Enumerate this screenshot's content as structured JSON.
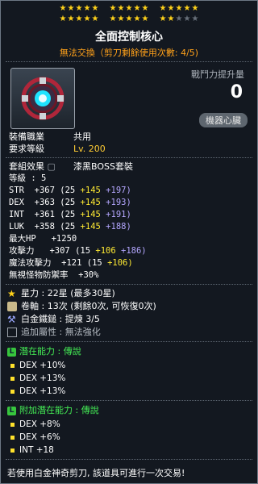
{
  "stars": {
    "row1": [
      [
        1,
        1,
        1,
        1,
        1
      ],
      [
        1,
        1,
        1,
        1,
        1
      ],
      [
        1,
        1,
        1,
        1,
        1
      ]
    ],
    "row2": [
      [
        1,
        1,
        1,
        1,
        1
      ],
      [
        1,
        1,
        1,
        1,
        1
      ],
      [
        1,
        1,
        0,
        0,
        0
      ]
    ],
    "filled_color": "#ffd21a",
    "empty_color": "#68707a"
  },
  "item": {
    "name": "全面控制核心",
    "trade_status": "無法交換（剪刀剩餘使用次數: 4/5)",
    "icon": "machine-heart-core-icon"
  },
  "power": {
    "label": "戰鬥力提升量",
    "value": "0"
  },
  "slot_badge": "機器心臟",
  "meta": [
    {
      "key": "裝備職業",
      "value": "共用",
      "color": "white"
    },
    {
      "key": "要求等級",
      "value": "Lv. 200",
      "color": "gold"
    }
  ],
  "set": {
    "key": "套組效果",
    "value": "漆黑BOSS套裝"
  },
  "level_line": "等級 : 5",
  "stats": [
    {
      "name": "STR",
      "total": "+367",
      "base": "(25",
      "bonus1": "+145",
      "bonus2": "+197)"
    },
    {
      "name": "DEX",
      "total": "+363",
      "base": "(25",
      "bonus1": "+145",
      "bonus2": "+193)"
    },
    {
      "name": "INT",
      "total": "+361",
      "base": "(25",
      "bonus1": "+145",
      "bonus2": "+191)"
    },
    {
      "name": "LUK",
      "total": "+358",
      "base": "(25",
      "bonus1": "+145",
      "bonus2": "+188)"
    }
  ],
  "hp_line": "最大HP   +1250",
  "attack": {
    "label": "攻擊力",
    "total": "+307",
    "base": "(15",
    "b1": "+106",
    "b2": "+186)"
  },
  "magic": {
    "label": "魔法攻擊力",
    "total": "+121",
    "base": "(15",
    "b1": "+106)"
  },
  "ignore_def": {
    "label": "無視怪物防禦率",
    "value": "+30%"
  },
  "misc": [
    {
      "icon": "star-icon",
      "text": "星力 : 22星 (最多30星)"
    },
    {
      "icon": "scroll-icon",
      "text": "卷軸 : 13次 (剩餘0次, 可恢復0次)"
    },
    {
      "icon": "hammer-icon",
      "text": "白金鐵鎚 : 提煉 3/5"
    },
    {
      "icon": "upgrade-icon",
      "text": "追加屬性 : 無法強化"
    }
  ],
  "potential": {
    "badge": "L",
    "title": "潛在能力 : 傳說",
    "lines": [
      "DEX +10%",
      "DEX +13%",
      "DEX +13%"
    ]
  },
  "bonus_potential": {
    "badge": "L",
    "title": "附加潛在能力 : 傳說",
    "lines": [
      "DEX +8%",
      "DEX +6%",
      "INT +18"
    ]
  },
  "footer": "若使用白金神奇剪刀, 該道具可進行一次交易!"
}
